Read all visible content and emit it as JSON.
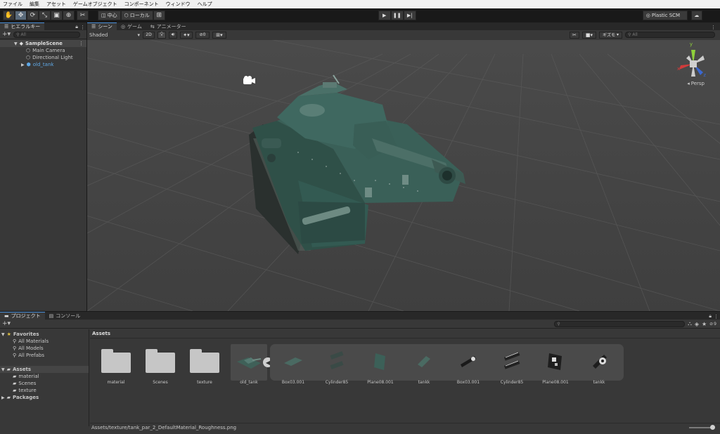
{
  "menu": [
    "ファイル",
    "編集",
    "アセット",
    "ゲームオブジェクト",
    "コンポーネント",
    "ウィンドウ",
    "ヘルプ"
  ],
  "toolbar": {
    "pivot_label": "中心",
    "space_label": "ローカル",
    "plastic_label": "Plastic SCM"
  },
  "hierarchy": {
    "tab_label": "ヒエラルキー",
    "search_placeholder": "All",
    "scene_name": "SampleScene",
    "items": [
      "Main Camera",
      "Directional Light",
      "old_tank"
    ]
  },
  "scene": {
    "tabs": [
      "シーン",
      "ゲーム",
      "アニメーター"
    ],
    "shading_mode": "Shaded",
    "mode_2d": "2D",
    "hidden_count": "0",
    "gizmos_label": "ギズモ",
    "search_placeholder": "All",
    "persp_label": "Persp",
    "axis_x": "x",
    "axis_y": "y",
    "axis_z": "z"
  },
  "project": {
    "tabs": [
      "プロジェクト",
      "コンソール"
    ],
    "tree": {
      "favorites_label": "Favorites",
      "favorites": [
        "All Materials",
        "All Models",
        "All Prefabs"
      ],
      "assets_label": "Assets",
      "asset_folders": [
        "material",
        "Scenes",
        "texture"
      ],
      "packages_label": "Packages"
    },
    "breadcrumb": "Assets",
    "grid_items": [
      "material",
      "Scenes",
      "texture",
      "old_tank",
      "Box03.001",
      "Cylinder85",
      "Plane08.001",
      "tankk",
      "Box03.001",
      "Cylinder85",
      "Plane08.001",
      "tankk"
    ],
    "hidden_count": "9",
    "status_path": "Assets/texture/tank_par_2_DefaultMaterial_Roughness.png"
  },
  "colors": {
    "tank_body": "#3a6058",
    "selection": "#4a8fd9",
    "axis_x": "#d13b3b",
    "axis_y": "#8fd13b",
    "axis_z": "#3b68d1"
  }
}
